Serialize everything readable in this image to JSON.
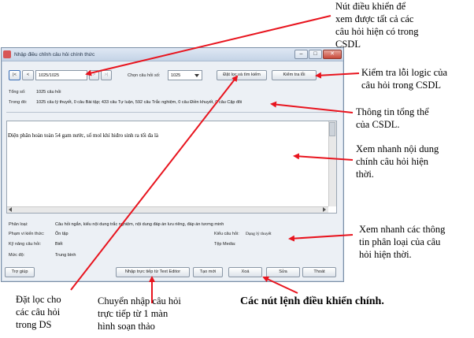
{
  "window": {
    "title": "Nhập điều chỉnh câu hỏi chính thức",
    "controls": {
      "minimize": "–",
      "maximize": "□",
      "close": "✕"
    }
  },
  "nav": {
    "first": "|<",
    "prev": "<",
    "next": ">",
    "last": ">|",
    "position_value": "1025/1025"
  },
  "selector": {
    "label": "Chọn câu hỏi số:",
    "value": "1025"
  },
  "buttons": {
    "filter_search": "Đặt lọc và tìm kiếm",
    "check_errors": "Kiểm tra lỗi",
    "help": "Trợ giúp",
    "direct_import": "Nhập trực tiếp từ Text Editor",
    "new": "Tạo mới",
    "delete": "Xoá",
    "edit": "Sửa",
    "exit": "Thoát"
  },
  "summary": {
    "total_label": "Tổng số:",
    "total_value": "1025 câu hỏi",
    "detail_label": "Trong đó:",
    "detail_value": "1025 câu lý thuyết, 0 câu Bài tập; 433 câu Tự luận, 592 câu Trắc nghiệm, 0 câu Điền khuyết, 0 câu Cặp đôi"
  },
  "content": {
    "question_text": "Điện phân hoàn toàn 54 gam nước, số mol khí hiđro sinh ra tối đa là"
  },
  "classification": {
    "type_label": "Phân loại:",
    "type_value": "Câu hỏi ngắn, kiểu nội dung trắc nghiệm, nội dung đáp án lưu riêng, đáp án tương minh",
    "scope_label": "Phạm vi kiến thức:",
    "scope_value": "Ôn tập",
    "skill_label": "Kỹ năng câu hỏi:",
    "skill_value": "Biết",
    "level_label": "Mức độ:",
    "level_value": "Trung bình",
    "qtype_label": "Kiểu câu hỏi:",
    "qtype_value": "Dạng lý thuyết",
    "media_label": "Tệp Media:",
    "media_value": ""
  },
  "annotations": {
    "nav_note": [
      "Nút điều khiển để",
      "xem được tất cả các",
      "câu hỏi hiện có trong",
      "CSDL"
    ],
    "check_note": [
      "Kiểm tra lỗi logic của",
      "câu hỏi trong CSDL"
    ],
    "summary_note": [
      "Thông tin tổng thể",
      "của CSDL."
    ],
    "content_note": [
      "Xem nhanh nội dung",
      "chính câu hỏi hiện",
      "thời."
    ],
    "class_note": [
      "Xem nhanh các thông",
      "tin phân loại của câu",
      "hỏi hiện thời."
    ],
    "filter_note": [
      "Đặt lọc cho",
      "các câu hỏi",
      "trong DS"
    ],
    "import_note": [
      "Chuyển nhập câu hỏi",
      "trực tiếp từ 1 màn",
      "hình soạn thảo"
    ],
    "main_buttons_note": "Các nút lệnh điều khiển chính."
  },
  "colors": {
    "arrow": "#e8141e",
    "window_bg": "#ecf0f5",
    "titlebar": "#c4d3e6"
  }
}
